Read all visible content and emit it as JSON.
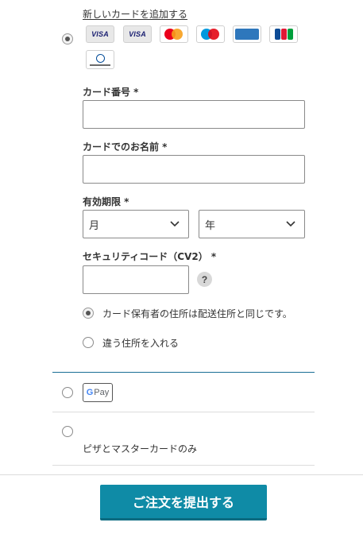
{
  "payment": {
    "add_card_link": "新しいカードを追加する",
    "card_logos": [
      {
        "name": "visa",
        "label": "VISA"
      },
      {
        "name": "visa",
        "label": "VISA"
      },
      {
        "name": "mastercard",
        "label": ""
      },
      {
        "name": "maestro",
        "label": ""
      },
      {
        "name": "american-express",
        "label": ""
      },
      {
        "name": "jcb",
        "label": ""
      },
      {
        "name": "diners-club",
        "label": ""
      }
    ],
    "card_number_label": "カード番号 *",
    "card_number_value": "",
    "card_name_label": "カードでのお名前 *",
    "card_name_value": "",
    "expiry_label": "有効期限 *",
    "month_selected": "月",
    "year_selected": "年",
    "security_label": "セキュリティコード（CV2） *",
    "security_value": "",
    "help_symbol": "?",
    "billing_same": "カード保有者の住所は配送住所と同じです。",
    "billing_different": "違う住所を入れる"
  },
  "google_pay": {
    "g": "G",
    "pay": "Pay"
  },
  "other_option": {
    "text": "ピザとマスターカードのみ"
  },
  "submit": {
    "label": "ご注文を提出する"
  },
  "colors": {
    "primary_button": "#0f8ba6",
    "divider_active": "#1a6f95"
  }
}
